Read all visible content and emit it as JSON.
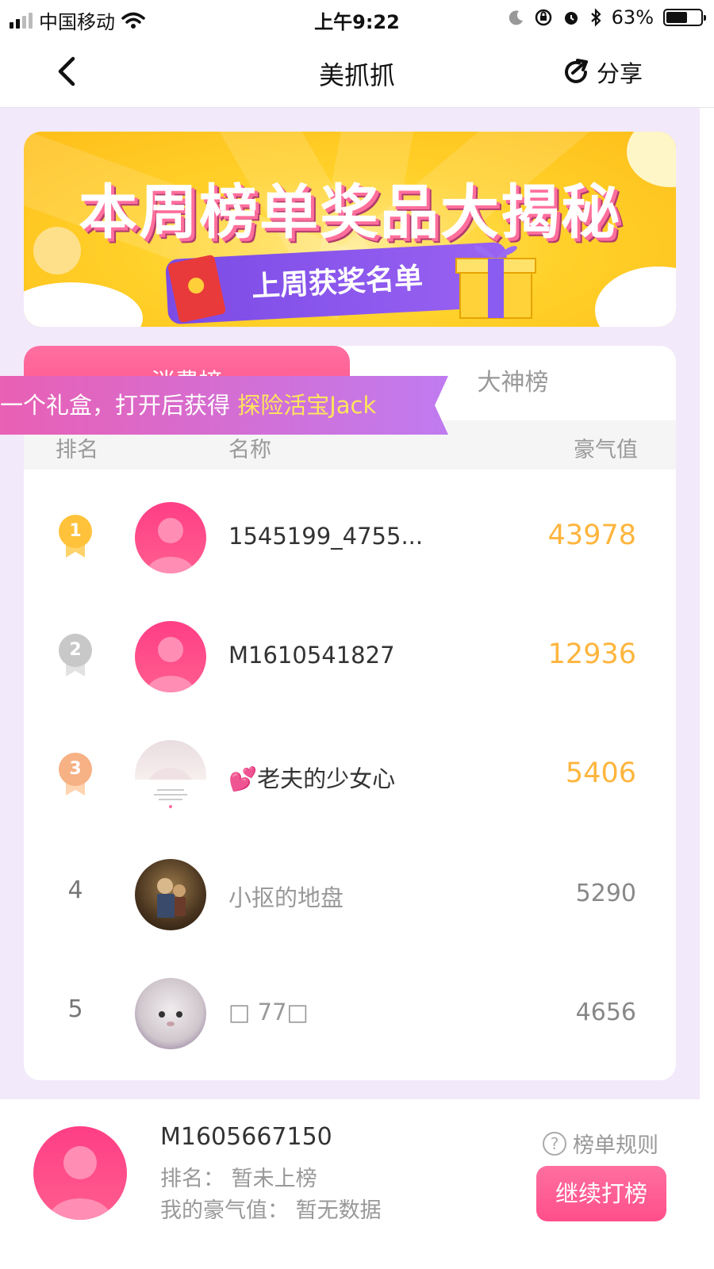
{
  "status_bar": {
    "carrier": "中国移动",
    "time": "上午9:22",
    "battery": "63%",
    "battery_level": 0.63
  },
  "nav": {
    "title": "美抓抓",
    "share_label": "分享"
  },
  "banner": {
    "title": "本周榜单奖品大揭秘",
    "ribbon": "上周获奖名单"
  },
  "tabs": [
    {
      "label": "消费榜",
      "active": true
    },
    {
      "label": "大神榜",
      "active": false
    }
  ],
  "toast": {
    "prefix": "一个礼盒，打开后获得 ",
    "highlight": "探险活宝Jack"
  },
  "table": {
    "headers": {
      "rank": "排名",
      "name": "名称",
      "score": "豪气值"
    },
    "rows": [
      {
        "rank": "1",
        "name": "1545199_4755...",
        "score": "43978",
        "medal": "gold"
      },
      {
        "rank": "2",
        "name": "M1610541827",
        "score": "12936",
        "medal": "silver"
      },
      {
        "rank": "3",
        "name": "💕老夫的少女心",
        "score": "5406",
        "medal": "bronze"
      },
      {
        "rank": "4",
        "name": "小抠的地盘",
        "score": "5290"
      },
      {
        "rank": "5",
        "name": "□ 77□",
        "score": "4656"
      }
    ]
  },
  "footer": {
    "my_name": "M1605667150",
    "my_rank": "排名：  暂未上榜",
    "my_score": "我的豪气值：  暂无数据",
    "rules_label": "榜单规则",
    "continue_label": "继续打榜"
  },
  "colors": {
    "accent_pink": "#ff4f8a",
    "score_gold": "#ffb53d",
    "page_bg": "#f2e9fb"
  }
}
